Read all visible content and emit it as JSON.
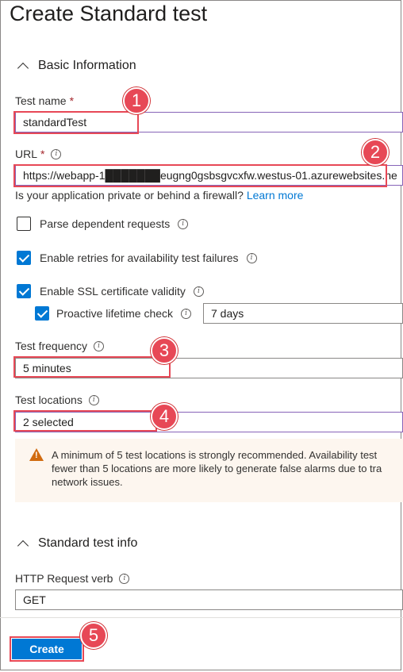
{
  "page": {
    "title": "Create Standard test"
  },
  "basic": {
    "section_title": "Basic Information",
    "test_name": {
      "label": "Test name",
      "required": "*",
      "value": "standardTest"
    },
    "url": {
      "label": "URL",
      "required": "*",
      "value": "https://webapp-1███████eugng0gsbsgvcxfw.westus-01.azurewebsites.ne"
    },
    "firewall_text": "Is your application private or behind a firewall?",
    "learn_more": "Learn more",
    "parse_dependent": {
      "label": "Parse dependent requests",
      "checked": false
    },
    "enable_retries": {
      "label": "Enable retries for availability test failures",
      "checked": true
    },
    "enable_ssl": {
      "label": "Enable SSL certificate validity",
      "checked": true
    },
    "proactive": {
      "label": "Proactive lifetime check",
      "checked": true,
      "value": "7 days"
    },
    "frequency": {
      "label": "Test frequency",
      "value": "5 minutes"
    },
    "locations": {
      "label": "Test locations",
      "value": "2 selected"
    },
    "warning": {
      "line1": "A minimum of 5 test locations is strongly recommended. Availability test",
      "line2": "fewer than 5 locations are more likely to generate false alarms due to tra",
      "line3": "network issues."
    }
  },
  "standard": {
    "section_title": "Standard test info",
    "verb": {
      "label": "HTTP Request verb",
      "value": "GET"
    }
  },
  "footer": {
    "create_label": "Create"
  },
  "callouts": [
    "1",
    "2",
    "3",
    "4",
    "5"
  ],
  "colors": {
    "accent": "#0078d4",
    "callout_red": "#e74856",
    "warning": "#d16b10"
  }
}
